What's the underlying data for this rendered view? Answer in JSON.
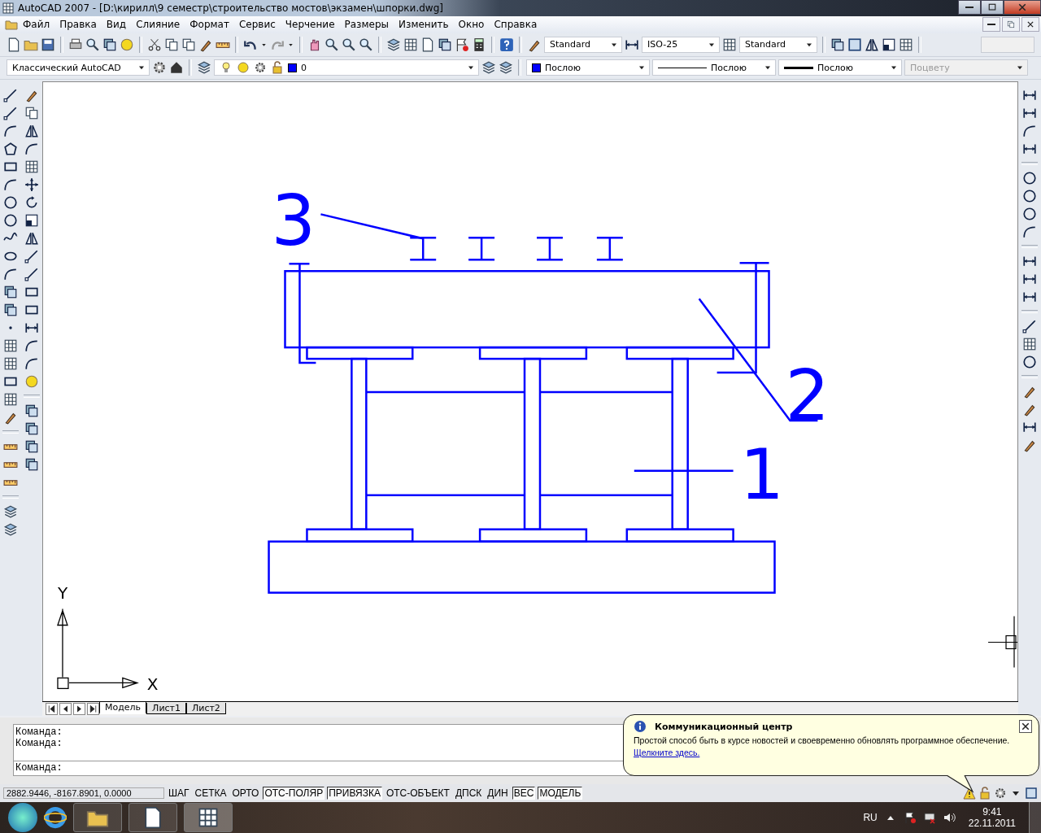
{
  "window": {
    "title": "AutoCAD 2007 - [D:\\кирилл\\9 семестр\\строительство мостов\\экзамен\\шпорки.dwg]"
  },
  "menu": [
    "Файл",
    "Правка",
    "Вид",
    "Слияние",
    "Формат",
    "Сервис",
    "Черчение",
    "Размеры",
    "Изменить",
    "Окно",
    "Справка"
  ],
  "styles": {
    "text_style": "Standard",
    "dim_style": "ISO-25",
    "table_style": "Standard"
  },
  "workspace": "Классический AutoCAD",
  "layer": "0",
  "properties": [
    {
      "label": "Послою",
      "kind": "color",
      "disabled": false
    },
    {
      "label": "Послою",
      "kind": "linetype",
      "disabled": false
    },
    {
      "label": "Послою",
      "kind": "lineweight",
      "disabled": false
    },
    {
      "label": "Поцвету",
      "kind": "plain",
      "disabled": true
    }
  ],
  "drawing": {
    "labels": [
      "3",
      "2",
      "1"
    ],
    "ucs_y": "Y",
    "ucs_x": "X"
  },
  "layout_tabs": [
    {
      "label": "Модель",
      "selected": true
    },
    {
      "label": "Лист1",
      "selected": false
    },
    {
      "label": "Лист2",
      "selected": false
    }
  ],
  "command_history": [
    "Команда:",
    "Команда:"
  ],
  "command_prompt": "Команда:",
  "status": {
    "coordinates": "2882.9446, -8167.8901, 0.0000",
    "toggles": [
      {
        "label": "ШАГ",
        "on": false
      },
      {
        "label": "СЕТКА",
        "on": false
      },
      {
        "label": "ОРТО",
        "on": false
      },
      {
        "label": "ОТС-ПОЛЯР",
        "on": true
      },
      {
        "label": "ПРИВЯЗКА",
        "on": true
      },
      {
        "label": "ОТС-ОБЪЕКТ",
        "on": false
      },
      {
        "label": "ДПСК",
        "on": false
      },
      {
        "label": "ДИН",
        "on": false
      },
      {
        "label": "ВЕС",
        "on": true
      },
      {
        "label": "МОДЕЛЬ",
        "on": true
      }
    ]
  },
  "balloon": {
    "title": "Коммуникационный центр",
    "text": "Простой способ быть в курсе новостей и своевременно обновлять программное обеспечение.",
    "link": "Щелкните здесь."
  },
  "taskbar": {
    "language": "RU",
    "time": "9:41",
    "date": "22.11.2011"
  }
}
